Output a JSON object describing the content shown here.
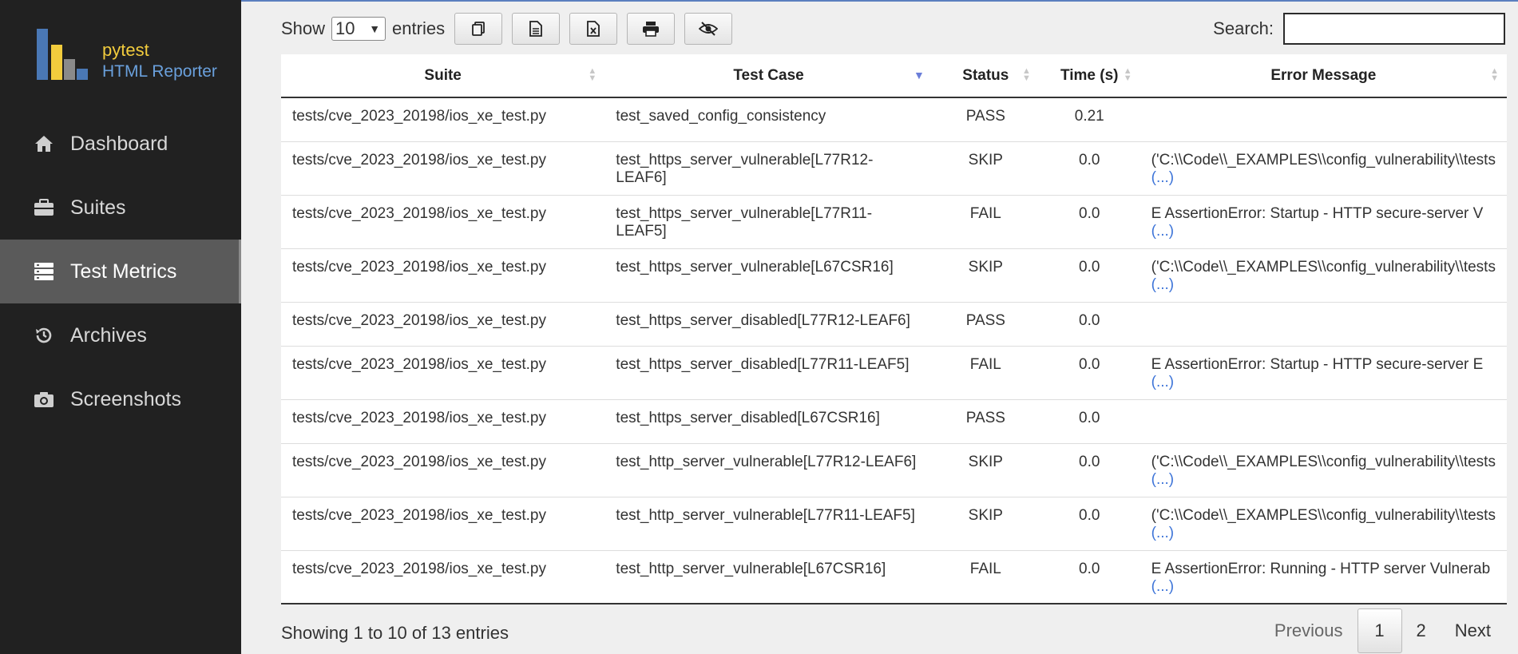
{
  "brand": {
    "line1": "pytest",
    "line2": "HTML Reporter"
  },
  "sidebar": {
    "items": [
      {
        "label": "Dashboard",
        "icon": "home-icon",
        "active": false
      },
      {
        "label": "Suites",
        "icon": "briefcase-icon",
        "active": false
      },
      {
        "label": "Test Metrics",
        "icon": "server-list-icon",
        "active": true
      },
      {
        "label": "Archives",
        "icon": "history-icon",
        "active": false
      },
      {
        "label": "Screenshots",
        "icon": "camera-icon",
        "active": false
      }
    ]
  },
  "toolbar": {
    "show_label": "Show",
    "entries_value": "10",
    "entries_label": "entries",
    "buttons": [
      "copy-icon",
      "csv-icon",
      "excel-icon",
      "print-icon",
      "column-visibility-icon"
    ]
  },
  "search": {
    "label": "Search:",
    "value": ""
  },
  "table": {
    "headers": [
      "Suite",
      "Test Case",
      "Status",
      "Time (s)",
      "Error Message"
    ],
    "sorted_column": "Test Case",
    "rows": [
      {
        "suite": "tests/cve_2023_20198/ios_xe_test.py",
        "test": "test_saved_config_consistency",
        "status": "PASS",
        "time": "0.21",
        "error": "",
        "more": ""
      },
      {
        "suite": "tests/cve_2023_20198/ios_xe_test.py",
        "test": "test_https_server_vulnerable[L77R12-LEAF6]",
        "status": "SKIP",
        "time": "0.0",
        "error": "('C:\\\\Code\\\\_EXAMPLES\\\\config_vulnerability\\\\tests",
        "more": "(...)"
      },
      {
        "suite": "tests/cve_2023_20198/ios_xe_test.py",
        "test": "test_https_server_vulnerable[L77R11-LEAF5]",
        "status": "FAIL",
        "time": "0.0",
        "error": "E AssertionError: Startup - HTTP secure-server V",
        "more": "(...)"
      },
      {
        "suite": "tests/cve_2023_20198/ios_xe_test.py",
        "test": "test_https_server_vulnerable[L67CSR16]",
        "status": "SKIP",
        "time": "0.0",
        "error": "('C:\\\\Code\\\\_EXAMPLES\\\\config_vulnerability\\\\tests",
        "more": "(...)"
      },
      {
        "suite": "tests/cve_2023_20198/ios_xe_test.py",
        "test": "test_https_server_disabled[L77R12-LEAF6]",
        "status": "PASS",
        "time": "0.0",
        "error": "",
        "more": ""
      },
      {
        "suite": "tests/cve_2023_20198/ios_xe_test.py",
        "test": "test_https_server_disabled[L77R11-LEAF5]",
        "status": "FAIL",
        "time": "0.0",
        "error": "E AssertionError: Startup - HTTP secure-server E",
        "more": "(...)"
      },
      {
        "suite": "tests/cve_2023_20198/ios_xe_test.py",
        "test": "test_https_server_disabled[L67CSR16]",
        "status": "PASS",
        "time": "0.0",
        "error": "",
        "more": ""
      },
      {
        "suite": "tests/cve_2023_20198/ios_xe_test.py",
        "test": "test_http_server_vulnerable[L77R12-LEAF6]",
        "status": "SKIP",
        "time": "0.0",
        "error": "('C:\\\\Code\\\\_EXAMPLES\\\\config_vulnerability\\\\tests",
        "more": "(...)"
      },
      {
        "suite": "tests/cve_2023_20198/ios_xe_test.py",
        "test": "test_http_server_vulnerable[L77R11-LEAF5]",
        "status": "SKIP",
        "time": "0.0",
        "error": "('C:\\\\Code\\\\_EXAMPLES\\\\config_vulnerability\\\\tests",
        "more": "(...)"
      },
      {
        "suite": "tests/cve_2023_20198/ios_xe_test.py",
        "test": "test_http_server_vulnerable[L67CSR16]",
        "status": "FAIL",
        "time": "0.0",
        "error": "E AssertionError: Running - HTTP server Vulnerab",
        "more": "(...)"
      }
    ]
  },
  "footer": {
    "info": "Showing 1 to 10 of 13 entries",
    "previous": "Previous",
    "pages": [
      "1",
      "2"
    ],
    "current_page": "1",
    "next": "Next"
  },
  "colors": {
    "sidebar": "#212121",
    "active_item": "#5a5a5a",
    "brand_yellow": "#f2cc3d",
    "brand_blue": "#6aa0dc",
    "link": "#3d74d8"
  }
}
